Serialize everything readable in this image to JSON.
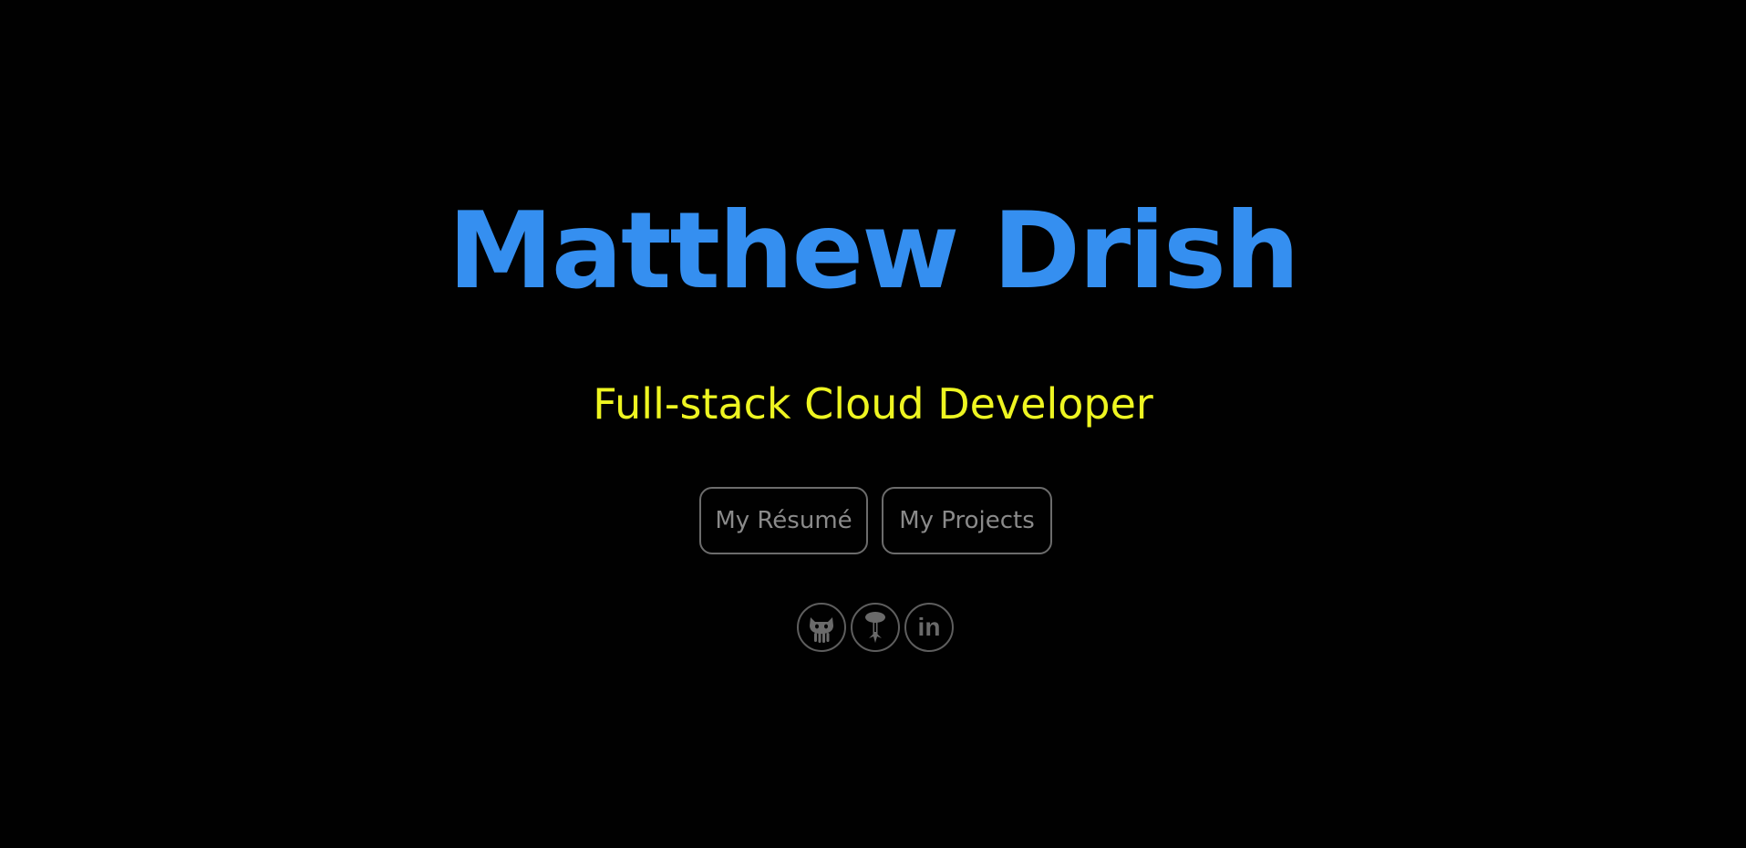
{
  "hero": {
    "name": "Matthew Drish",
    "tagline": "Full-stack Cloud Developer"
  },
  "buttons": {
    "resume_label": "My Résumé",
    "projects_label": "My Projects"
  },
  "social_links": [
    {
      "icon": "github-octocat-icon"
    },
    {
      "icon": "mushroom-cloud-blog-icon"
    },
    {
      "icon": "linkedin-icon",
      "label": "in"
    }
  ],
  "colors": {
    "background": "#010101",
    "name": "#358ff0",
    "tagline": "#eef521",
    "button_border": "#6c6c6c",
    "button_text": "#8a8a8a",
    "icon": "#6a6a6a"
  }
}
